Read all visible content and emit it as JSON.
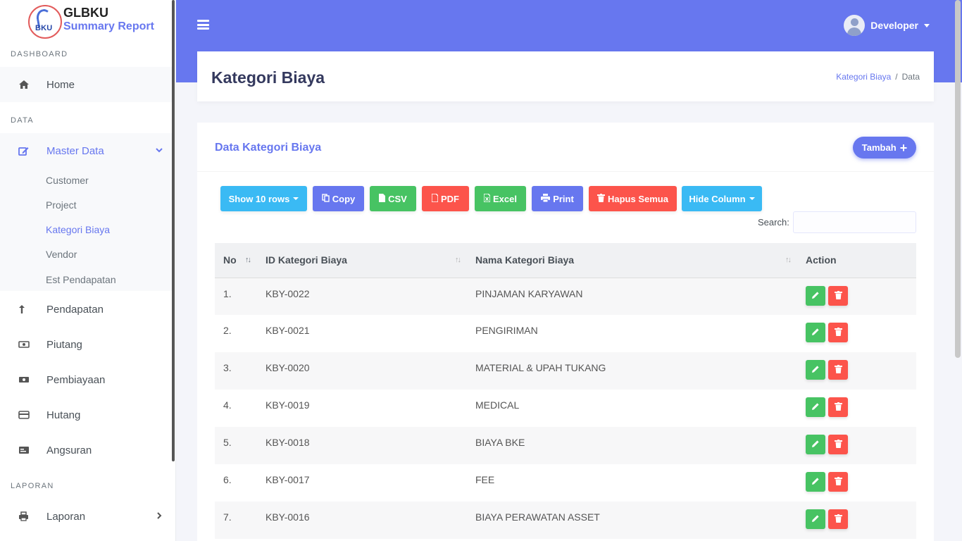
{
  "brand": {
    "logo_text": "BKU",
    "title": "GLBKU",
    "subtitle": "Summary Report"
  },
  "sidebar": {
    "sections": {
      "dashboard": "DASHBOARD",
      "data": "DATA",
      "laporan": "LAPORAN"
    },
    "home": "Home",
    "master_data": "Master Data",
    "sub_items": [
      "Customer",
      "Project",
      "Kategori Biaya",
      "Vendor",
      "Est Pendapatan"
    ],
    "items": [
      "Pendapatan",
      "Piutang",
      "Pembiayaan",
      "Hutang",
      "Angsuran"
    ],
    "laporan": "Laporan"
  },
  "header": {
    "user": "Developer"
  },
  "page": {
    "title": "Kategori Biaya",
    "breadcrumb": [
      "Kategori Biaya",
      "Data"
    ]
  },
  "card": {
    "title": "Data Kategori Biaya",
    "add_button": "Tambah",
    "toolbar": {
      "show_rows": "Show 10 rows",
      "copy": "Copy",
      "csv": "CSV",
      "pdf": "PDF",
      "excel": "Excel",
      "print": "Print",
      "hapus_semua": "Hapus Semua",
      "hide_column": "Hide Column"
    },
    "search_label": "Search:",
    "search_value": ""
  },
  "table": {
    "headers": [
      "No",
      "ID Kategori Biaya",
      "Nama Kategori Biaya",
      "Action"
    ],
    "rows": [
      {
        "no": "1.",
        "id": "KBY-0022",
        "nama": "PINJAMAN KARYAWAN"
      },
      {
        "no": "2.",
        "id": "KBY-0021",
        "nama": "PENGIRIMAN"
      },
      {
        "no": "3.",
        "id": "KBY-0020",
        "nama": "MATERIAL & UPAH TUKANG"
      },
      {
        "no": "4.",
        "id": "KBY-0019",
        "nama": "MEDICAL"
      },
      {
        "no": "5.",
        "id": "KBY-0018",
        "nama": "BIAYA BKE"
      },
      {
        "no": "6.",
        "id": "KBY-0017",
        "nama": "FEE"
      },
      {
        "no": "7.",
        "id": "KBY-0016",
        "nama": "BIAYA PERAWATAN ASSET"
      }
    ]
  },
  "colors": {
    "primary": "#6777ef",
    "info": "#3abaf4",
    "success": "#47c363",
    "danger": "#fc544b"
  }
}
